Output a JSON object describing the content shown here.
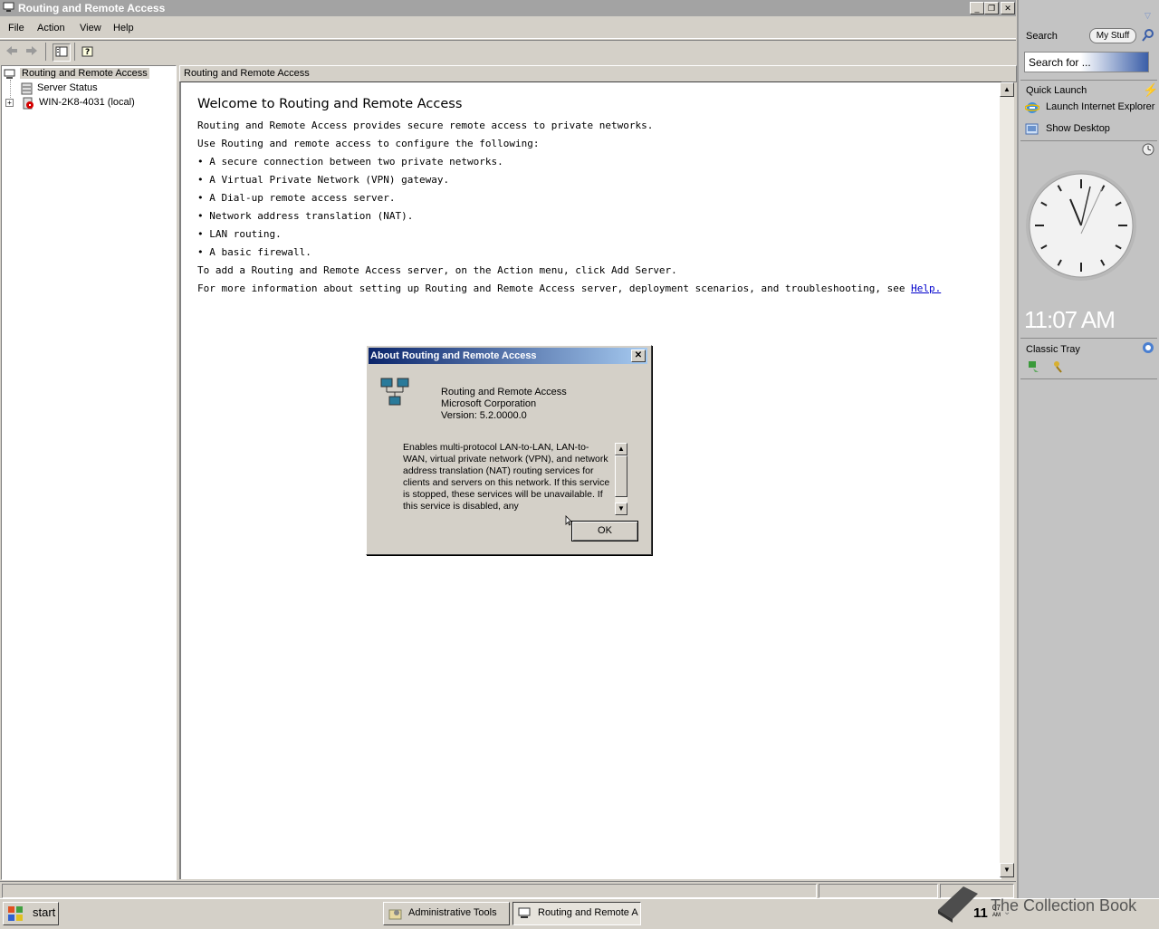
{
  "window": {
    "title": "Routing and Remote Access",
    "minimize_glyph": "_",
    "restore_glyph": "❐",
    "close_glyph": "✕"
  },
  "menu": [
    "File",
    "Action",
    "View",
    "Help"
  ],
  "toolbar": {
    "icons": [
      "back-arrow-icon",
      "forward-arrow-icon",
      "show-hide-tree-icon",
      "help-icon"
    ]
  },
  "tree": {
    "root": "Routing and Remote Access",
    "children": [
      "Server Status",
      "WIN-2K8-4031 (local)"
    ],
    "expander": "+"
  },
  "content": {
    "header": "Routing and Remote Access",
    "welcome_title": "Welcome to Routing and Remote Access",
    "intro": "Routing and Remote Access provides secure remote access to private networks.",
    "use_line": "Use Routing and remote access to configure the following:",
    "bullets": [
      "• A secure connection between two private networks.",
      "• A Virtual Private Network (VPN) gateway.",
      "• A Dial-up remote access server.",
      "• Network address translation (NAT).",
      "• LAN routing.",
      "• A basic firewall."
    ],
    "add_server": "To add a Routing and Remote Access server, on the Action menu, click Add Server.",
    "more_info": "For more information about setting up Routing and Remote Access server, deployment scenarios, and troubleshooting, see ",
    "help_link": "Help."
  },
  "dialog": {
    "title": "About Routing and Remote Access",
    "product": "Routing and Remote Access",
    "company": "Microsoft Corporation",
    "version": "Version: 5.2.0000.0",
    "description": "Enables multi-protocol LAN-to-LAN, LAN-to-WAN, virtual private network (VPN), and network address translation (NAT) routing services for clients and servers on this network. If this service is stopped, these services will be unavailable. If this service is disabled, any",
    "ok": "OK"
  },
  "sidebar": {
    "search_label": "Search",
    "my_stuff": "My Stuff",
    "search_placeholder": "Search for ...",
    "quick_launch": "Quick Launch",
    "launch_ie": "Launch Internet Explorer",
    "show_desktop": "Show Desktop",
    "clock_time": "11:07 AM",
    "classic_tray": "Classic Tray"
  },
  "taskbar": {
    "start": "start",
    "tasks": [
      "Administrative Tools",
      "Routing and Remote A"
    ],
    "clock_hour": "11",
    "clock_min": "07",
    "clock_ampm": "AM",
    "watermark": "The Collection Book"
  }
}
